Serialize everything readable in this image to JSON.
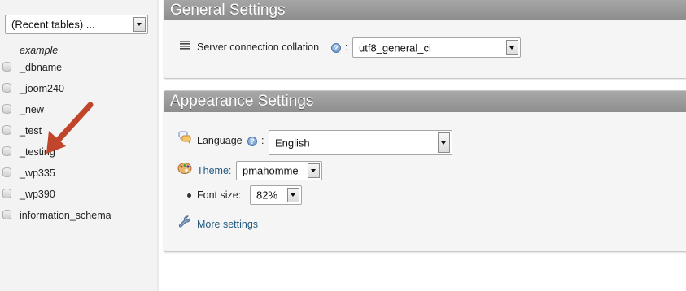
{
  "navigation": {
    "recent_tables_select": {
      "value": "(Recent tables) ..."
    },
    "db_list_header": "example",
    "databases": [
      "_dbname",
      "_joom240",
      "_new",
      "_test",
      "_testing",
      "_wp335",
      "_wp390",
      "information_schema"
    ],
    "arrow_color": "#c0452a"
  },
  "general_settings": {
    "title": "General Settings",
    "collation": {
      "label": "Server connection collation",
      "colon": ":",
      "value": "utf8_general_ci"
    }
  },
  "appearance_settings": {
    "title": "Appearance Settings",
    "language": {
      "label": "Language",
      "colon": ":",
      "value": "English"
    },
    "theme": {
      "label": "Theme:",
      "value": "pmahomme"
    },
    "font_size": {
      "label": "Font size:",
      "value": "82%"
    },
    "more_settings": "More settings"
  },
  "colors": {
    "panel_title_bg": "#999999",
    "link": "#235a81",
    "nav_bg": "#f3f3f3"
  }
}
